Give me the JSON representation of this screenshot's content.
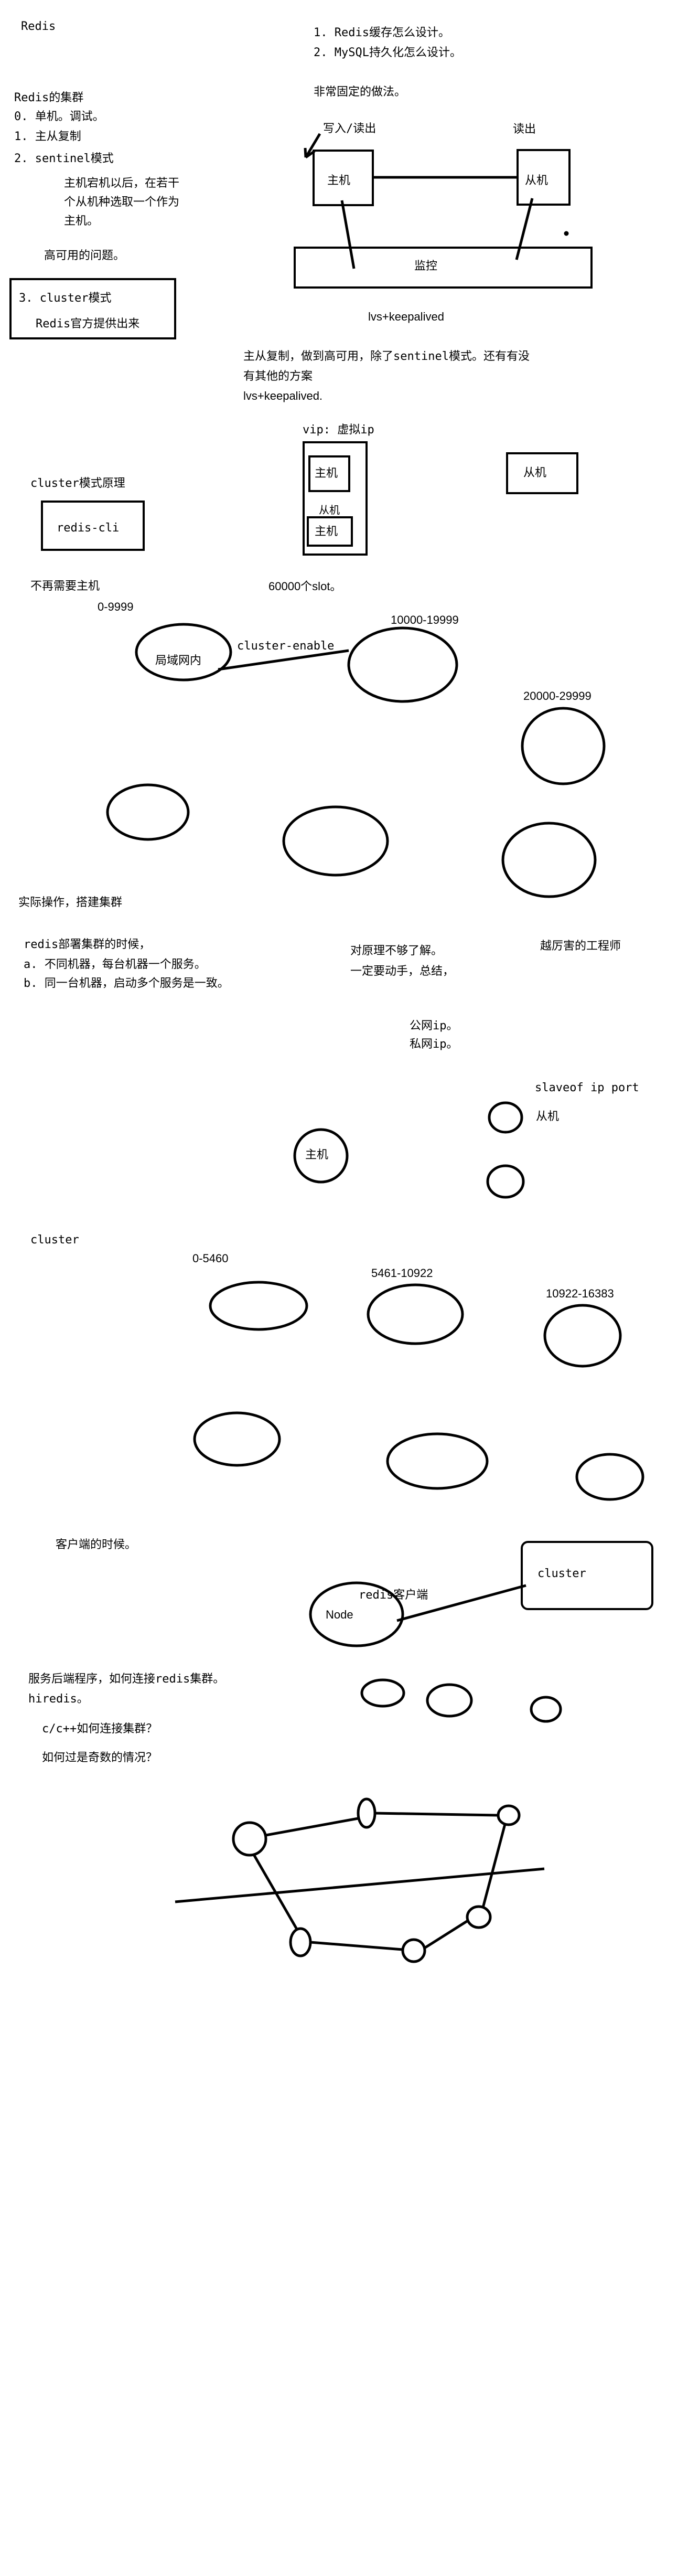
{
  "title": "Redis",
  "top_questions": [
    "1. Redis缓存怎么设计。",
    "2. MySQL持久化怎么设计。"
  ],
  "fixed_practice": "非常固定的做法。",
  "write_read": "写入/读出",
  "read": "读出",
  "master": "主机",
  "slave": "从机",
  "monitor": "监控",
  "lvs": "lvs+keepalived",
  "cluster_heading": "Redis的集群",
  "cluster_list": [
    "0. 单机。调试。",
    "1. 主从复制",
    "2. sentinel模式"
  ],
  "sentinel_note": [
    "主机宕机以后，在若干",
    "个从机种选取一个作为",
    "主机。"
  ],
  "ha_problem": "高可用的问题。",
  "cluster_mode_box": [
    "3. cluster模式",
    "Redis官方提供出来"
  ],
  "ha_question": [
    "主从复制，做到高可用，除了sentinel模式。还有有没",
    "有其他的方案",
    "lvs+keepalived."
  ],
  "vip": "vip:  虚拟ip",
  "cluster_principle": "cluster模式原理",
  "redis_cli": "redis-cli",
  "no_master": "不再需要主机",
  "slots": "60000个slot。",
  "range1": "0-9999",
  "lan": "局域网内",
  "cluster_enable": "cluster-enable",
  "range2": "10000-19999",
  "range3": "20000-29999",
  "practice": "实际操作，搭建集群",
  "deploy": [
    "redis部署集群的时候，",
    "a. 不同机器，每台机器一个服务。",
    "b. 同一台机器，启动多个服务是一致。"
  ],
  "principle_note": [
    "对原理不够了解。",
    "一定要动手，总结，"
  ],
  "great_engineer": "越厉害的工程师",
  "ips": [
    "公网ip。",
    "私网ip。"
  ],
  "slaveof": "slaveof ip port",
  "cluster2": "cluster",
  "r1": "0-5460",
  "r2": "5461-10922",
  "r3": "10922-16383",
  "client_time": "客户端的时候。",
  "redis_client": "redis客户端",
  "node": "Node",
  "server_connect": [
    "服务后端程序，如何连接redis集群。",
    "hiredis。"
  ],
  "c_question": "c/c++如何连接集群？",
  "odd_question": "如何过是奇数的情况？"
}
